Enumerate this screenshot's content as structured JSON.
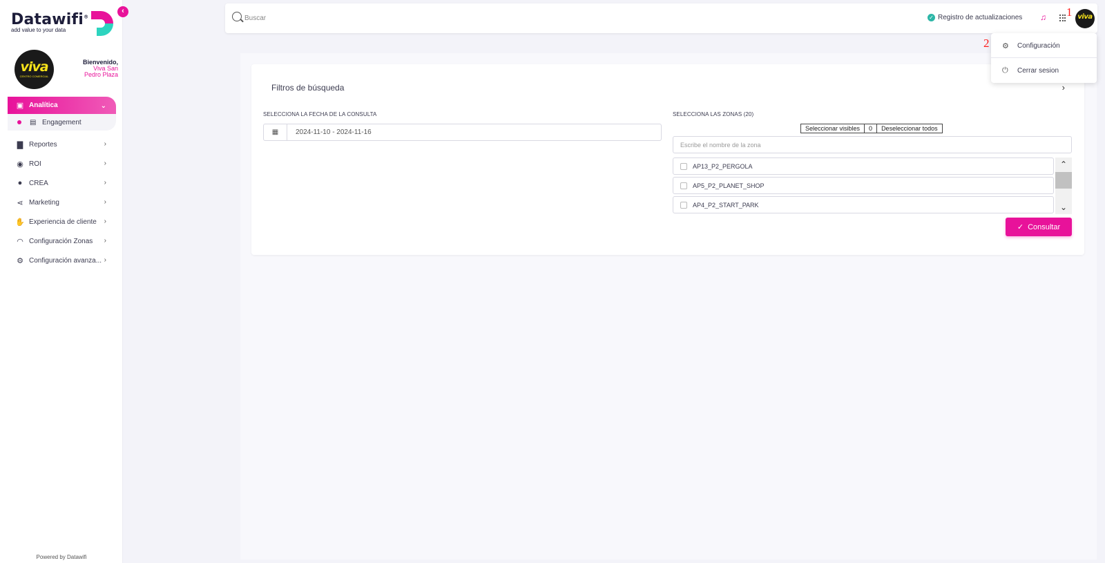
{
  "brand": {
    "name": "Datawifi",
    "tagline": "add value to your data",
    "reg": "®",
    "accent": "#e8129a"
  },
  "profile": {
    "logo_text": "viva",
    "logo_sub": "CENTRO COMERCIAL",
    "welcome": "Bienvenido,",
    "place_line1": "Viva San",
    "place_line2": "Pedro Plaza"
  },
  "sidebar": {
    "items": [
      {
        "label": "Analítica",
        "icon": "chart-icon"
      },
      {
        "label": "Engagement",
        "icon": "contact-icon"
      },
      {
        "label": "Reportes",
        "icon": "file-icon"
      },
      {
        "label": "ROI",
        "icon": "money-icon"
      },
      {
        "label": "CREA",
        "icon": "bulb-icon"
      },
      {
        "label": "Marketing",
        "icon": "share-icon"
      },
      {
        "label": "Experiencia de cliente",
        "icon": "thumbs-up-icon"
      },
      {
        "label": "Configuración Zonas",
        "icon": "wifi-icon"
      },
      {
        "label": "Configuración avanza...",
        "icon": "gear-icon"
      }
    ],
    "footer": "Powered by Datawifi"
  },
  "topbar": {
    "search_placeholder": "Buscar",
    "updates_label": "Registro de actualizaciones",
    "avatar_text": "viva",
    "annotation_1": "1",
    "annotation_2": "2"
  },
  "dropdown": {
    "items": [
      {
        "label": "Configuración",
        "icon": "gear-icon"
      },
      {
        "label": "Cerrar sesion",
        "icon": "power-icon"
      }
    ]
  },
  "filters": {
    "title": "Filtros de búsqueda",
    "date_label": "SELECCIONA LA FECHA DE LA CONSULTA",
    "date_value": "2024-11-10 - 2024-11-16",
    "zones_label": "SELECCIONA LAS ZONAS (20)",
    "select_visible": "Seleccionar visibles",
    "count": "0",
    "deselect_all": "Deseleccionar todos",
    "zone_search_placeholder": "Escribe el nombre de la zona",
    "zones": [
      "AP13_P2_PERGOLA",
      "AP5_P2_PLANET_SHOP",
      "AP4_P2_START_PARK"
    ],
    "consult_label": "Consultar"
  }
}
